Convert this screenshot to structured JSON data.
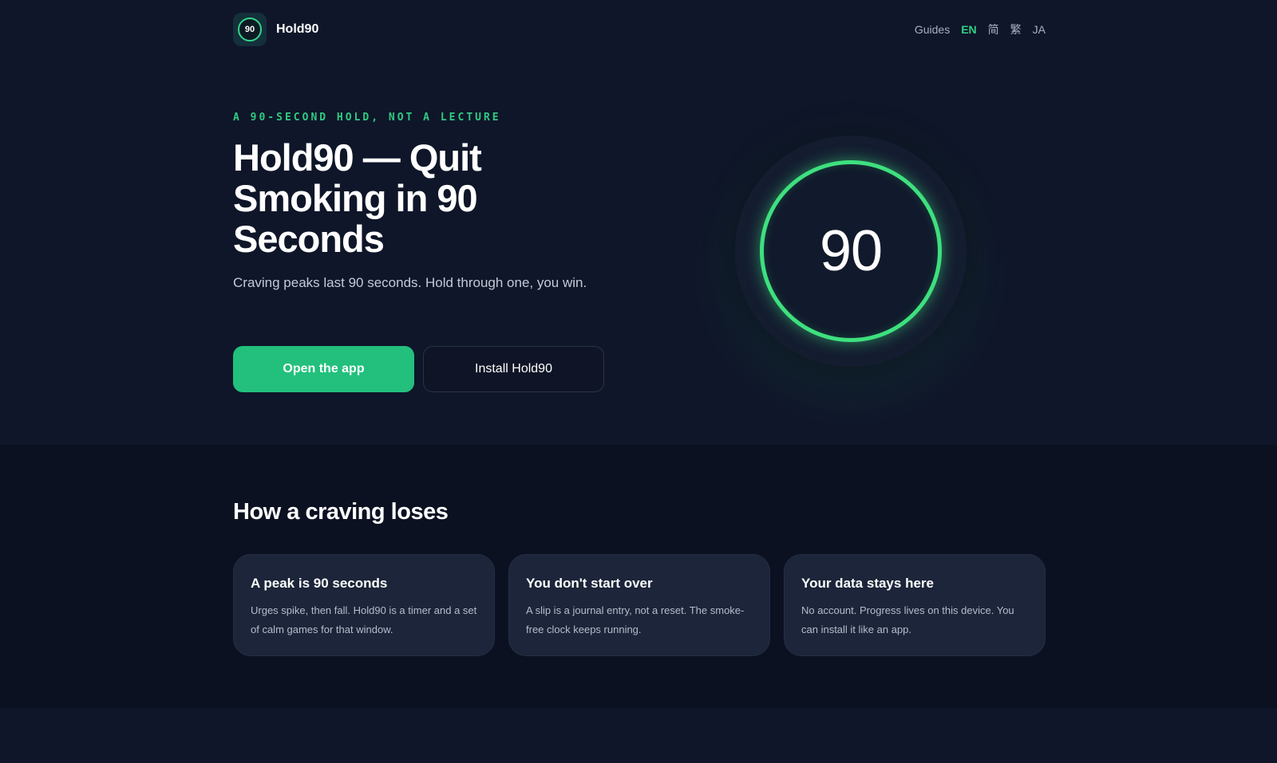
{
  "header": {
    "logo_text": "90",
    "brand": "Hold90",
    "nav": [
      {
        "label": "Guides",
        "active": false
      },
      {
        "label": "EN",
        "active": true
      },
      {
        "label": "简",
        "active": false
      },
      {
        "label": "繁",
        "active": false
      },
      {
        "label": "JA",
        "active": false
      }
    ]
  },
  "hero": {
    "eyebrow": "A 90-SECOND HOLD, NOT A LECTURE",
    "title": "Hold90 — Quit Smoking in 90 Seconds",
    "subtitle": "Craving peaks last 90 seconds. Hold through one, you win.",
    "primary_button": "Open the app",
    "secondary_button": "Install Hold90",
    "timer_value": "90"
  },
  "how": {
    "title": "How a craving loses",
    "cards": [
      {
        "title": "A peak is 90 seconds",
        "text": "Urges spike, then fall. Hold90 is a timer and a set of calm games for that window."
      },
      {
        "title": "You don't start over",
        "text": "A slip is a journal entry, not a reset. The smoke-free clock keeps running."
      },
      {
        "title": "Your data stays here",
        "text": "No account. Progress lives on this device. You can install it like an app."
      }
    ]
  },
  "colors": {
    "background": "#0f1629",
    "section_background": "#0b1121",
    "accent": "#22c07c",
    "ring": "#3ee07e",
    "card": "#1c2539"
  }
}
